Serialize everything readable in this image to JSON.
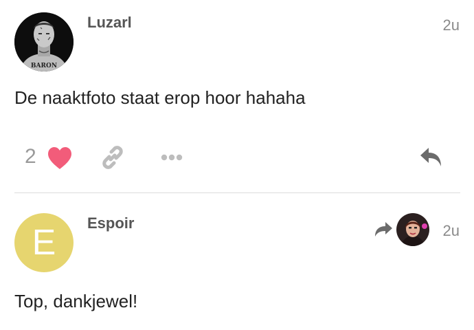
{
  "posts": [
    {
      "username": "Luzarl",
      "time": "2u",
      "body": "De naaktfoto staat erop hoor hahaha",
      "like_count": "2",
      "avatar_text": "BARON"
    },
    {
      "username": "Espoir",
      "time": "2u",
      "body": "Top, dankjewel!",
      "avatar_letter": "E"
    }
  ],
  "colors": {
    "heart": "#f25c7a",
    "muted_icon": "#bdbdbd",
    "reply_icon": "#6b6b6b",
    "espoir_avatar": "#e6d56f"
  },
  "icons": {
    "like": "heart-icon",
    "share_link": "link-icon",
    "more": "ellipsis-icon",
    "reply": "reply-icon",
    "reply_to": "share-arrow-icon"
  }
}
